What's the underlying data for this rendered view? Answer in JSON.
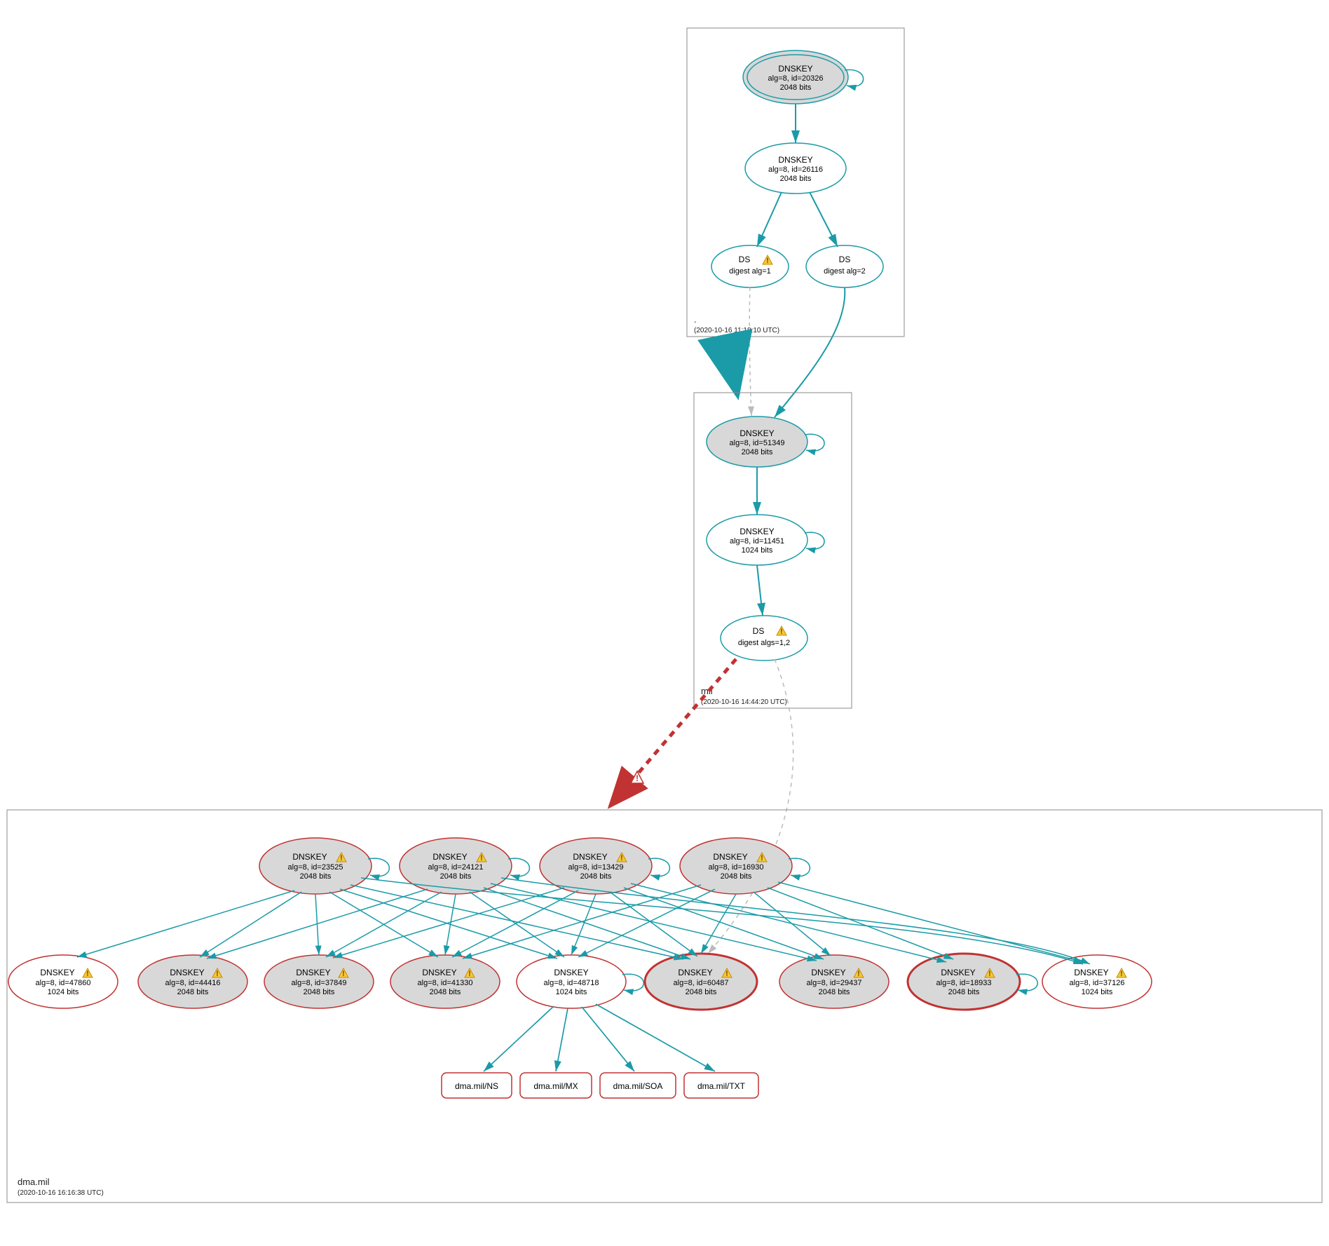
{
  "zones": {
    "root": {
      "name": ".",
      "time": "(2020-10-16 11:18:10 UTC)"
    },
    "mil": {
      "name": "mil",
      "time": "(2020-10-16 14:44:20 UTC)"
    },
    "dma": {
      "name": "dma.mil",
      "time": "(2020-10-16 16:16:38 UTC)"
    }
  },
  "nodes": {
    "root_ksk": {
      "title": "DNSKEY",
      "l2": "alg=8, id=20326",
      "l3": "2048 bits"
    },
    "root_zsk": {
      "title": "DNSKEY",
      "l2": "alg=8, id=26116",
      "l3": "2048 bits"
    },
    "root_ds1": {
      "title": "DS",
      "l2": "digest alg=1"
    },
    "root_ds2": {
      "title": "DS",
      "l2": "digest alg=2"
    },
    "mil_ksk": {
      "title": "DNSKEY",
      "l2": "alg=8, id=51349",
      "l3": "2048 bits"
    },
    "mil_zsk": {
      "title": "DNSKEY",
      "l2": "alg=8, id=11451",
      "l3": "1024 bits"
    },
    "mil_ds": {
      "title": "DS",
      "l2": "digest algs=1,2"
    },
    "d_t0": {
      "title": "DNSKEY",
      "l2": "alg=8, id=23525",
      "l3": "2048 bits"
    },
    "d_t1": {
      "title": "DNSKEY",
      "l2": "alg=8, id=24121",
      "l3": "2048 bits"
    },
    "d_t2": {
      "title": "DNSKEY",
      "l2": "alg=8, id=13429",
      "l3": "2048 bits"
    },
    "d_t3": {
      "title": "DNSKEY",
      "l2": "alg=8, id=16930",
      "l3": "2048 bits"
    },
    "d_b0": {
      "title": "DNSKEY",
      "l2": "alg=8, id=47860",
      "l3": "1024 bits"
    },
    "d_b1": {
      "title": "DNSKEY",
      "l2": "alg=8, id=44416",
      "l3": "2048 bits"
    },
    "d_b2": {
      "title": "DNSKEY",
      "l2": "alg=8, id=37849",
      "l3": "2048 bits"
    },
    "d_b3": {
      "title": "DNSKEY",
      "l2": "alg=8, id=41330",
      "l3": "2048 bits"
    },
    "d_b4": {
      "title": "DNSKEY",
      "l2": "alg=8, id=48718",
      "l3": "1024 bits"
    },
    "d_b5": {
      "title": "DNSKEY",
      "l2": "alg=8, id=60487",
      "l3": "2048 bits"
    },
    "d_b6": {
      "title": "DNSKEY",
      "l2": "alg=8, id=29437",
      "l3": "2048 bits"
    },
    "d_b7": {
      "title": "DNSKEY",
      "l2": "alg=8, id=18933",
      "l3": "2048 bits"
    },
    "d_b8": {
      "title": "DNSKEY",
      "l2": "alg=8, id=37126",
      "l3": "1024 bits"
    }
  },
  "rr": {
    "ns": "dma.mil/NS",
    "mx": "dma.mil/MX",
    "soa": "dma.mil/SOA",
    "txt": "dma.mil/TXT"
  }
}
